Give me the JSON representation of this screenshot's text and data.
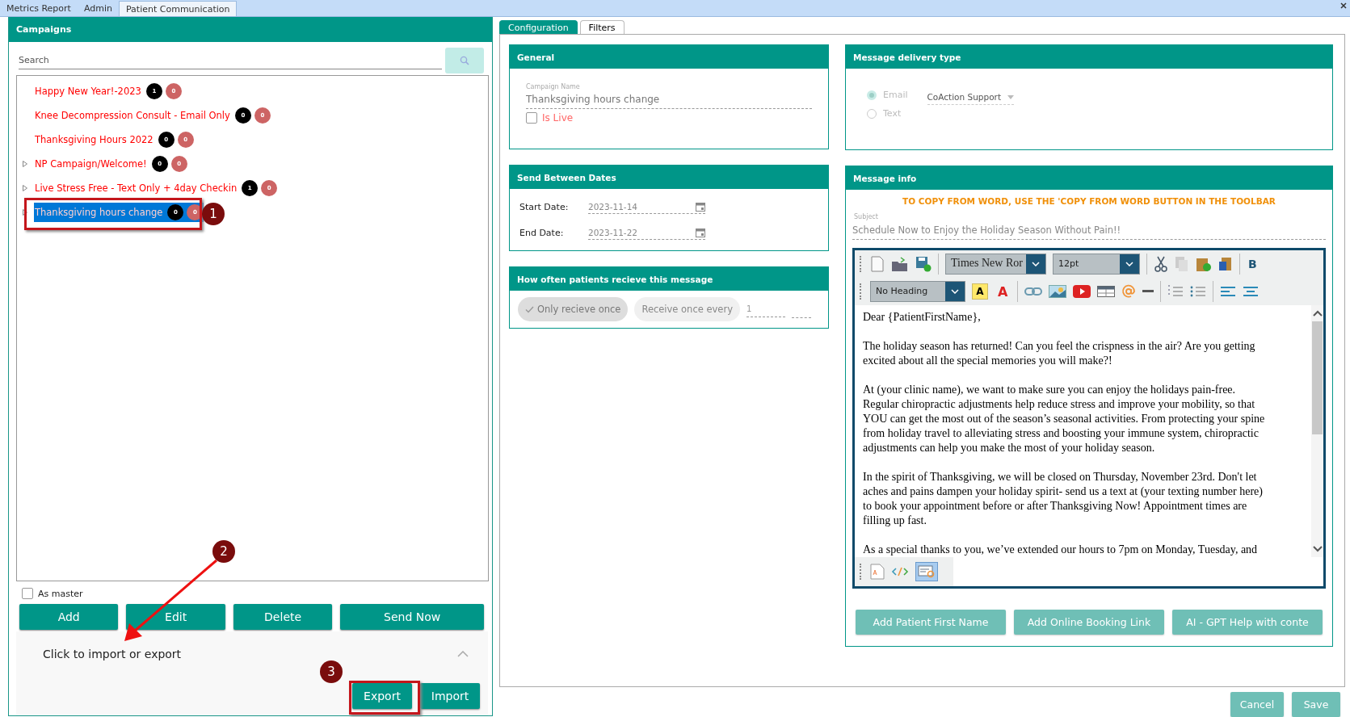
{
  "top_tabs": [
    {
      "label": "Metrics Report",
      "selected": false
    },
    {
      "label": "Admin",
      "selected": false
    },
    {
      "label": "Patient Communication",
      "selected": true
    }
  ],
  "campaigns": {
    "title": "Campaigns",
    "search": {
      "placeholder": "Search"
    },
    "items": [
      {
        "label": "Happy New Year!-2023",
        "expandable": false,
        "selected": false,
        "badges": [
          {
            "text": "1",
            "color": "#000000"
          },
          {
            "text": "0",
            "color": "#cd6464"
          }
        ]
      },
      {
        "label": "Knee Decompression Consult - Email Only",
        "expandable": false,
        "selected": false,
        "badges": [
          {
            "text": "0",
            "color": "#000000"
          },
          {
            "text": "0",
            "color": "#cd6464"
          }
        ]
      },
      {
        "label": "Thanksgiving Hours 2022",
        "expandable": false,
        "selected": false,
        "badges": [
          {
            "text": "0",
            "color": "#000000"
          },
          {
            "text": "0",
            "color": "#cd6464"
          }
        ]
      },
      {
        "label": "NP Campaign/Welcome!",
        "expandable": true,
        "selected": false,
        "badges": [
          {
            "text": "0",
            "color": "#000000"
          },
          {
            "text": "0",
            "color": "#cd6464"
          }
        ]
      },
      {
        "label": "Live Stress Free - Text Only + 4day Checkin",
        "expandable": true,
        "selected": false,
        "badges": [
          {
            "text": "1",
            "color": "#000000"
          },
          {
            "text": "0",
            "color": "#cd6464"
          }
        ]
      },
      {
        "label": "Thanksgiving hours change",
        "expandable": true,
        "selected": true,
        "badges": [
          {
            "text": "0",
            "color": "#000000"
          },
          {
            "text": "0",
            "color": "#cd6464"
          }
        ]
      }
    ],
    "as_master": {
      "label": "As master",
      "checked": false
    },
    "buttons": [
      "Add",
      "Edit",
      "Delete",
      "Send Now"
    ],
    "import_export": {
      "label": "Click to import or export",
      "expanded": true,
      "buttons": [
        "Export",
        "Import"
      ]
    }
  },
  "annotations": [
    {
      "label": "1"
    },
    {
      "label": "2"
    },
    {
      "label": "3"
    }
  ],
  "config_tabs": [
    {
      "label": "Configuration",
      "selected": true
    },
    {
      "label": "Filters",
      "selected": false
    }
  ],
  "general": {
    "title": "General",
    "campaign_name_label": "Campaign Name",
    "campaign_name": "Thanksgiving hours change",
    "is_live": {
      "label": "Is Live",
      "checked": false
    }
  },
  "dates": {
    "title": "Send Between Dates",
    "rows": [
      {
        "label": "Start Date:",
        "value": "2023-11-14"
      },
      {
        "label": "End Date:",
        "value": "2023-11-22"
      }
    ]
  },
  "frequency": {
    "title": "How often patients recieve this message",
    "options": [
      {
        "label": "Only recieve once",
        "selected": true
      },
      {
        "label": "Receive once every",
        "selected": false
      }
    ],
    "count": "1"
  },
  "delivery": {
    "title": "Message delivery type",
    "options": [
      {
        "label": "Email",
        "selected": true
      },
      {
        "label": "Text",
        "selected": false
      }
    ],
    "sender": "CoAction Support"
  },
  "message": {
    "title": "Message info",
    "notice": "TO COPY FROM WORD, USE THE 'COPY FROM WORD BUTTON IN THE TOOLBAR",
    "subject_label": "Subject",
    "subject": "Schedule Now to Enjoy the Holiday Season Without Pain!!",
    "editor": {
      "font": "Times New Ror",
      "size": "12pt",
      "heading": "No Heading",
      "bold": "B",
      "highlight": "A",
      "font_color": "A",
      "paragraphs": [
        "Dear {PatientFirstName},",
        "The holiday season has returned! Can you feel the crispness in the air? Are you getting excited about all the special memories you will make?!",
        "At (your clinic name), we want to make sure you can enjoy the holidays pain-free. Regular chiropractic adjustments help reduce stress and improve your mobility, so that YOU can get the most out of the season’s seasonal activities. From protecting your spine from holiday travel to alleviating stress and boosting your immune system, chiropractic adjustments can help you make the most of your holiday season.",
        "In the spirit of Thanksgiving, we will be closed on Thursday, November 23rd. Don't let aches and pains dampen your holiday spirit- send us a text at (your texting number here) to book your appointment before or after Thanksgiving Now! Appointment times are filling up fast.",
        "As a special thanks to you, we’ve extended our hours to 7pm on Monday, Tuesday, and"
      ]
    },
    "buttons": [
      "Add Patient First Name",
      "Add Online Booking Link",
      "AI - GPT Help with conte"
    ]
  },
  "footer_buttons": [
    "Cancel",
    "Save"
  ]
}
